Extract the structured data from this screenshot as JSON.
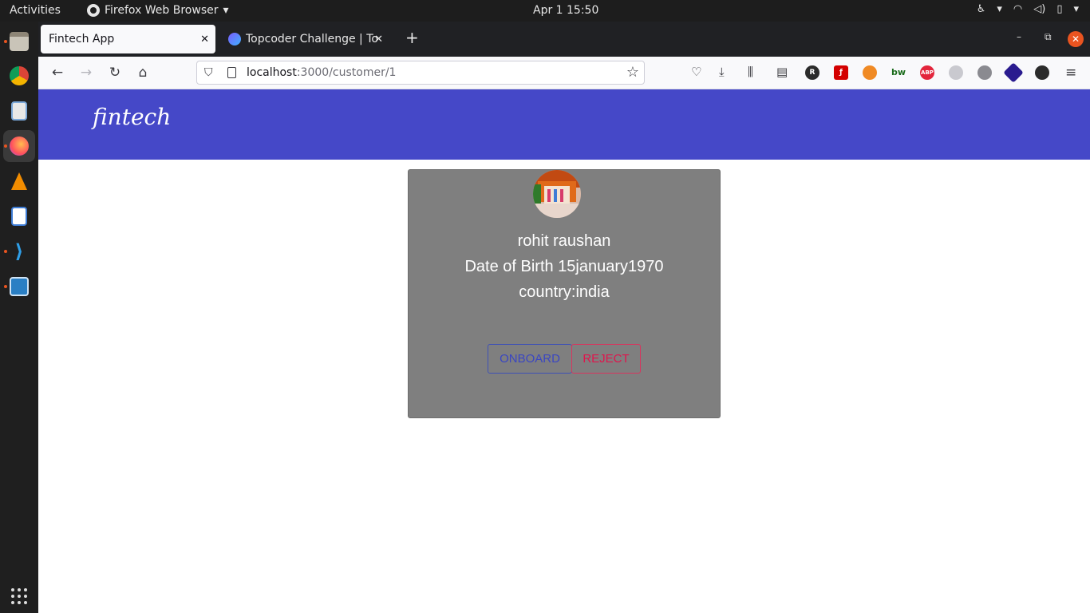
{
  "system": {
    "activities": "Activities",
    "app_name": "Firefox Web Browser",
    "clock": "Apr 1  15:50"
  },
  "tabs": [
    {
      "title": "Fintech App",
      "active": true
    },
    {
      "title": "Topcoder Challenge | Top",
      "active": false
    }
  ],
  "address_bar": {
    "host": "localhost",
    "path": ":3000/customer/1"
  },
  "app": {
    "brand": "fintech",
    "header_color": "#4548c8"
  },
  "customer": {
    "name": "rohit raushan",
    "dob": "Date of Birth 15january1970",
    "country": "country:india",
    "onboard_label": "ONBOARD",
    "reject_label": "REJECT"
  },
  "extensions": [
    {
      "name": "R",
      "color": "#2b2b2b"
    },
    {
      "name": "ABP",
      "color": "#e3253c"
    }
  ]
}
